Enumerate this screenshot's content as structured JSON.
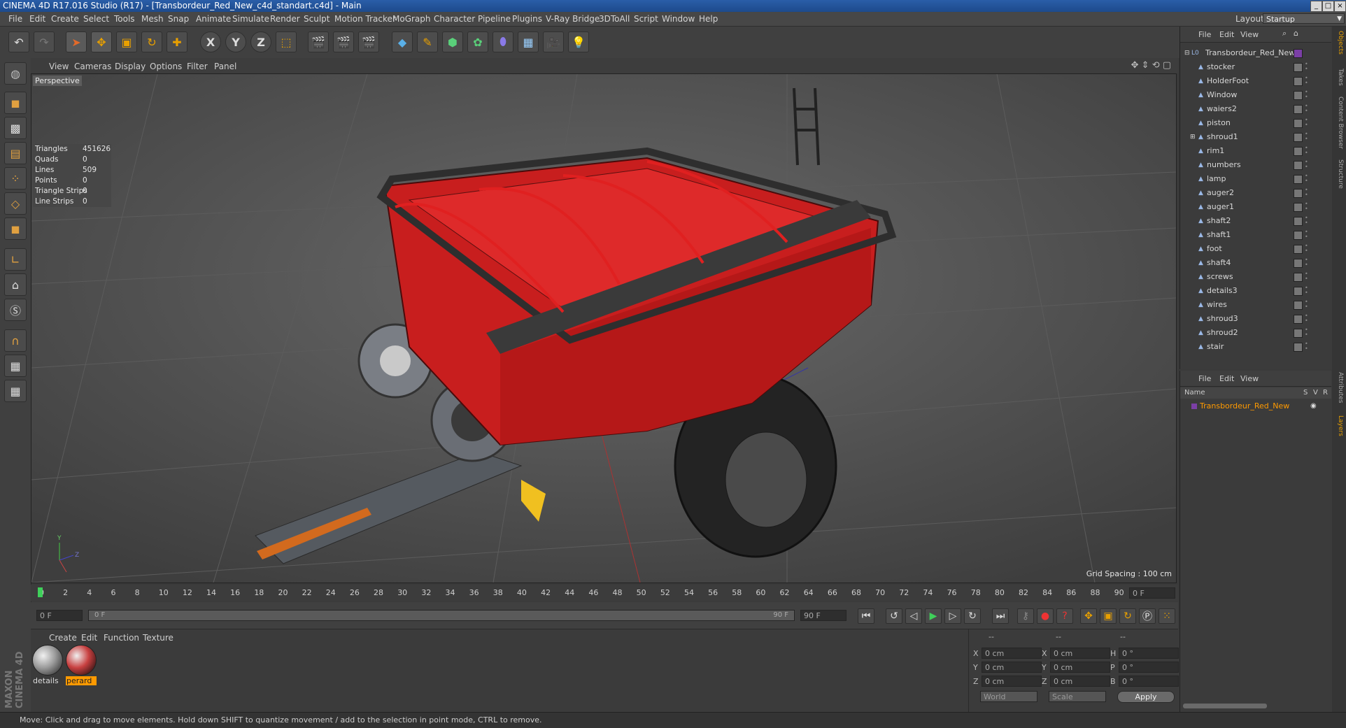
{
  "window": {
    "title": "CINEMA 4D R17.016 Studio (R17) - [Transbordeur_Red_New_c4d_standart.c4d] - Main"
  },
  "menu": [
    "File",
    "Edit",
    "Create",
    "Select",
    "Tools",
    "Mesh",
    "Snap",
    "Animate",
    "Simulate",
    "Render",
    "Sculpt",
    "Motion Tracker",
    "MoGraph",
    "Character",
    "Pipeline",
    "Plugins",
    "V-Ray Bridge",
    "3DToAll",
    "Script",
    "Window",
    "Help"
  ],
  "layout": {
    "label": "Layout:",
    "value": "Startup"
  },
  "toolbar": {
    "undo": "undo-icon",
    "redo": "redo-icon",
    "axis_x": "X",
    "axis_y": "Y",
    "axis_z": "Z"
  },
  "viewport": {
    "menu": [
      "View",
      "Cameras",
      "Display",
      "Options",
      "Filter",
      "Panel"
    ],
    "camera_label": "Perspective",
    "stats": [
      {
        "k": "Triangles",
        "v": "451626"
      },
      {
        "k": "Quads",
        "v": "0"
      },
      {
        "k": "Lines",
        "v": "509"
      },
      {
        "k": "Points",
        "v": "0"
      },
      {
        "k": "Triangle Strips",
        "v": "0"
      },
      {
        "k": "Line Strips",
        "v": "0"
      }
    ],
    "grid_spacing": "Grid Spacing : 100 cm"
  },
  "timeline": {
    "ticks": [
      "0",
      "2",
      "4",
      "6",
      "8",
      "10",
      "12",
      "14",
      "16",
      "18",
      "20",
      "22",
      "24",
      "26",
      "28",
      "30",
      "32",
      "34",
      "36",
      "38",
      "40",
      "42",
      "44",
      "46",
      "48",
      "50",
      "52",
      "54",
      "56",
      "58",
      "60",
      "62",
      "64",
      "66",
      "68",
      "70",
      "72",
      "74",
      "76",
      "78",
      "80",
      "82",
      "84",
      "86",
      "88",
      "90"
    ],
    "current_frame": "0 F",
    "start_field": "0 F",
    "range_start": "0 F",
    "range_end": "90 F",
    "end_field": "90 F"
  },
  "materials": {
    "menu": [
      "Create",
      "Edit",
      "Function",
      "Texture"
    ],
    "items": [
      {
        "name": "details",
        "selected": false
      },
      {
        "name": "perard",
        "selected": true
      }
    ]
  },
  "coords": {
    "headers": [
      "--",
      "--",
      "--"
    ],
    "rows": [
      {
        "a": "X",
        "av": "0 cm",
        "b": "X",
        "bv": "0 cm",
        "c": "H",
        "cv": "0 °"
      },
      {
        "a": "Y",
        "av": "0 cm",
        "b": "Y",
        "bv": "0 cm",
        "c": "P",
        "cv": "0 °"
      },
      {
        "a": "Z",
        "av": "0 cm",
        "b": "Z",
        "bv": "0 cm",
        "c": "B",
        "cv": "0 °"
      }
    ],
    "world": "World",
    "scale": "Scale",
    "apply": "Apply"
  },
  "objects": {
    "menu": [
      "File",
      "Edit",
      "View"
    ],
    "root": "Transbordeur_Red_New",
    "items": [
      "stocker",
      "HolderFoot",
      "Window",
      "waiers2",
      "piston",
      "shroud1",
      "rim1",
      "numbers",
      "lamp",
      "auger2",
      "auger1",
      "shaft2",
      "shaft1",
      "foot",
      "shaft4",
      "screws",
      "details3",
      "wires",
      "shroud3",
      "shroud2",
      "stair"
    ]
  },
  "layers": {
    "menu": [
      "File",
      "Edit",
      "View"
    ],
    "col_name": "Name",
    "cols": [
      "S",
      "V",
      "R"
    ],
    "item": "Transbordeur_Red_New"
  },
  "right_tabs": [
    "Objects",
    "Takes",
    "Content Browser",
    "Structure",
    "Attributes",
    "Layers"
  ],
  "brand": "MAXON CINEMA 4D",
  "status": "Move: Click and drag to move elements. Hold down SHIFT to quantize movement / add to the selection in point mode, CTRL to remove.",
  "colors": {
    "accent": "#e8a000",
    "trailer_red": "#c81e1e",
    "selection": "#ff9a00"
  }
}
